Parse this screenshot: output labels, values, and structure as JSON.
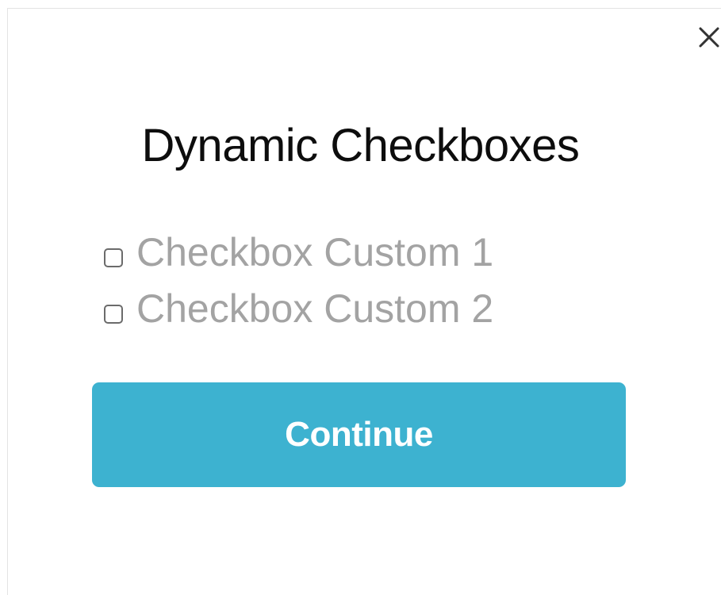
{
  "modal": {
    "close_icon": "close-icon",
    "title": "Dynamic Checkboxes",
    "checkboxes": [
      {
        "label": "Checkbox Custom 1",
        "checked": false
      },
      {
        "label": "Checkbox Custom 2",
        "checked": false
      }
    ],
    "continue_label": "Continue"
  },
  "colors": {
    "button_background": "#3db2d0",
    "button_text": "#ffffff",
    "checkbox_label": "#a3a3a3",
    "title": "#0d0d0d"
  }
}
